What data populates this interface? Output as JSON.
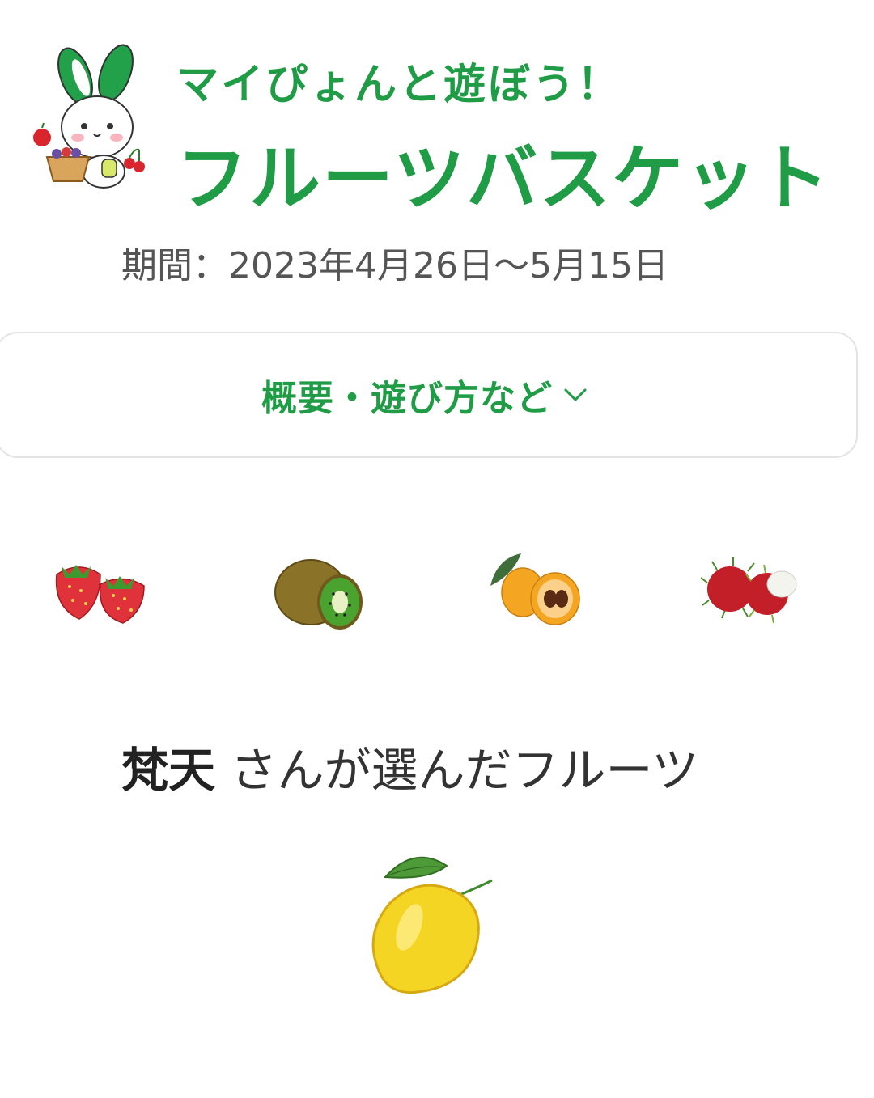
{
  "header": {
    "subtitle": "マイぴょんと遊ぼう！",
    "title": "フルーツバスケット",
    "mascot_icon": "rabbit-with-fruit-basket-icon"
  },
  "period": {
    "text": "期間：2023年4月26日〜5月15日"
  },
  "summary_button": {
    "label": "概要・遊び方など",
    "icon": "chevron-down-icon"
  },
  "fruits": [
    {
      "name": "strawberry",
      "icon": "strawberry-icon"
    },
    {
      "name": "kiwi",
      "icon": "kiwi-icon"
    },
    {
      "name": "loquat",
      "icon": "loquat-icon"
    },
    {
      "name": "rambutan",
      "icon": "rambutan-icon"
    }
  ],
  "choice": {
    "name": "梵天",
    "suffix": " さんが選んだフルーツ",
    "selected_fruit_icon": "lemon-icon"
  },
  "colors": {
    "accent": "#1f9c45",
    "text": "#555555",
    "border": "#e3e3e3"
  }
}
